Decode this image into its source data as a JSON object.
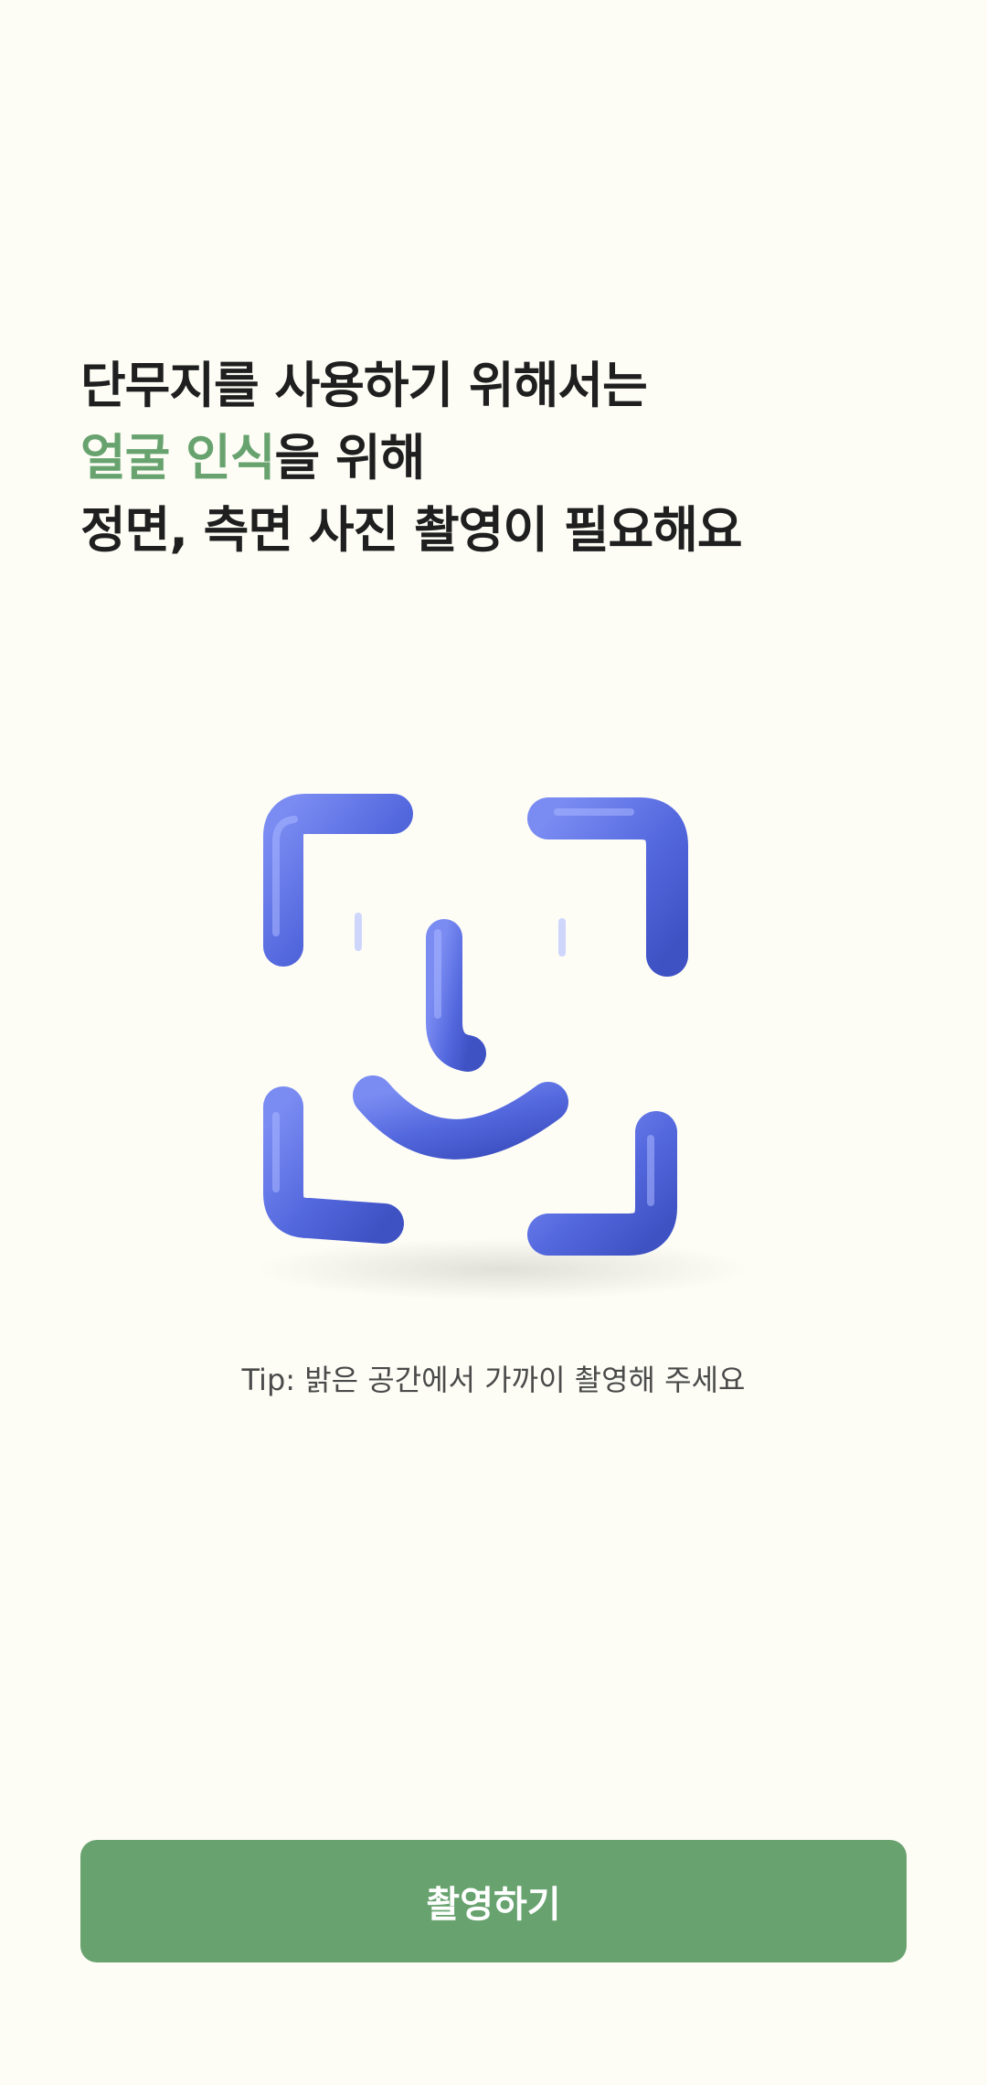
{
  "headline": {
    "line1": "단무지를 사용하기 위해서는",
    "line2_accent": "얼굴 인식",
    "line2_rest": "을 위해",
    "line3": "정면, 측면 사진 촬영이 필요해요"
  },
  "illustration": {
    "icon": "face-id-icon",
    "color": "#5a6fe0"
  },
  "tip": {
    "label": "Tip:",
    "text": " 밝은 공간에서 가까이 촬영해 주세요"
  },
  "primary_button": {
    "label": "촬영하기"
  },
  "colors": {
    "background": "#fdfdf6",
    "accent": "#68a36f",
    "text": "#1f1f1f"
  }
}
